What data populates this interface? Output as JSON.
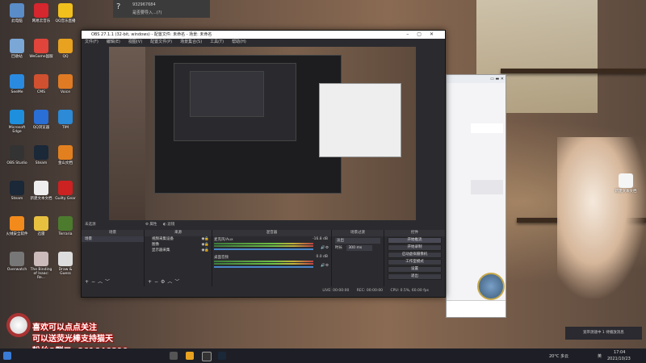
{
  "notification": {
    "number": "932967684",
    "text": "是否要导入...(?)"
  },
  "desktop_icons_left": [
    {
      "label": "此电脑",
      "color": "#5a8cc8"
    },
    {
      "label": "网易云音乐",
      "color": "#d6262e"
    },
    {
      "label": "QQ音乐直播",
      "color": "#f2c01c"
    },
    {
      "label": "回收站",
      "color": "#7aa7d6"
    },
    {
      "label": "WeGame国服",
      "color": "#e0443a"
    },
    {
      "label": "QQ",
      "color": "#e8a21f"
    },
    {
      "label": "SeeMe",
      "color": "#2a8ae0"
    },
    {
      "label": "CMS",
      "color": "#d05030"
    },
    {
      "label": "Voice",
      "color": "#e07b24"
    },
    {
      "label": "Microsoft Edge",
      "color": "#1d8fdc"
    },
    {
      "label": "QQ浏览器",
      "color": "#2a6fd6"
    },
    {
      "label": "TIM",
      "color": "#2c8ad6"
    },
    {
      "label": "OBS Studio",
      "color": "#333"
    },
    {
      "label": "Steam",
      "color": "#1a2838"
    },
    {
      "label": "金山文档",
      "color": "#e28020"
    },
    {
      "label": "Steam",
      "color": "#1a2838"
    },
    {
      "label": "新建文本文档",
      "color": "#eee"
    },
    {
      "label": "Guilty Gear",
      "color": "#c22"
    },
    {
      "label": "火绒安全软件",
      "color": "#f28a1c"
    },
    {
      "label": "迅雷",
      "color": "#e8c040"
    },
    {
      "label": "Terraria",
      "color": "#4c7b2e"
    },
    {
      "label": "Overwatch",
      "color": "#777"
    },
    {
      "label": "The Binding of Isaac: Re...",
      "color": "#cbb"
    },
    {
      "label": "Draw & Guess",
      "color": "#ddd"
    }
  ],
  "desktop_icon_right": {
    "label": "新建文本文档"
  },
  "obs": {
    "title": "OBS 27.1.1 (32-bit, windows) - 配置文件: 未命名 - 场景: 未命名",
    "menu": [
      "文件(F)",
      "编辑(E)",
      "视图(V)",
      "配置文件(P)",
      "场景集合(S)",
      "工具(T)",
      "帮助(H)"
    ],
    "status_bar": {
      "source_label": "未选源",
      "props": "属性",
      "filters": "滤镜",
      "live": "LIVE: 00:00:00",
      "rec": "REC: 00:00:00",
      "cpu": "CPU: 0.5%, 60.00 fps"
    },
    "scenes": {
      "header": "场景",
      "items": [
        "场景"
      ]
    },
    "sources": {
      "header": "来源",
      "items": [
        "视频采集设备",
        "图像",
        "显示器采集"
      ]
    },
    "mixer": {
      "header": "混音器",
      "channels": [
        {
          "name": "麦克风/Aux",
          "db": "-16.8 dB"
        },
        {
          "name": "桌面音频",
          "db": "0.0 dB"
        }
      ]
    },
    "transitions": {
      "header": "场景过渡",
      "type": "淡出",
      "duration_label": "时长",
      "duration": "300 ms"
    },
    "controls": {
      "header": "控件",
      "buttons": [
        "开始推流",
        "开始录制",
        "启动虚拟摄像机",
        "工作室模式",
        "设置",
        "退出"
      ]
    }
  },
  "overlay": {
    "line1": "喜欢可以点点关注",
    "line2": "可以送荧光棒支持猫天",
    "line3": "粉丝Q群二: 861646890"
  },
  "taskbar": {
    "weather": "20°C 多云",
    "ime": "英",
    "time": "17:04",
    "date": "2021/10/23",
    "notification": "宽带测速中 1 待播放消息"
  }
}
